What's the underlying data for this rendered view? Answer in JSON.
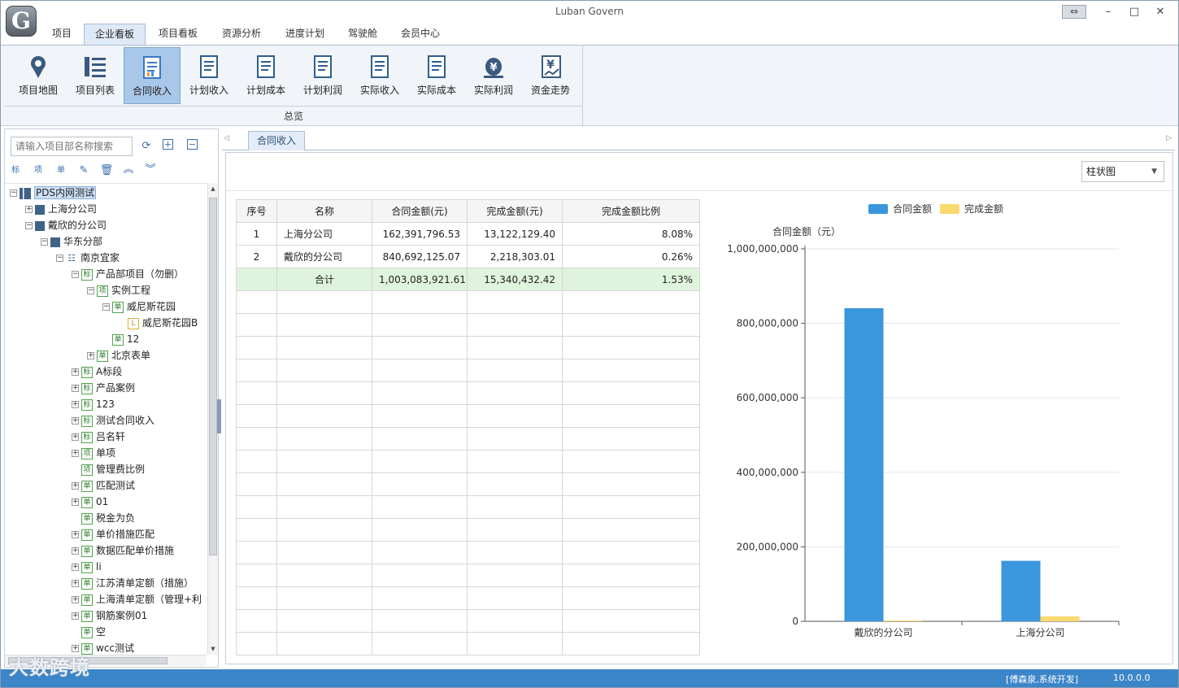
{
  "app": {
    "title": "Luban Govern",
    "logo_letter": "G",
    "restore_glyph": "⇔",
    "min_glyph": "–",
    "max_glyph": "□",
    "close_glyph": "✕"
  },
  "menu_tabs": [
    "项目",
    "企业看板",
    "项目看板",
    "资源分析",
    "进度计划",
    "驾驶舱",
    "会员中心"
  ],
  "active_menu_tab": "企业看板",
  "ribbon": {
    "group_label": "总览",
    "buttons": [
      {
        "label": "项目地图",
        "icon": "map-icon"
      },
      {
        "label": "项目列表",
        "icon": "list-icon"
      },
      {
        "label": "合同收入",
        "icon": "contract-income-icon",
        "active": true
      },
      {
        "label": "计划收入",
        "icon": "planned-income-icon"
      },
      {
        "label": "计划成本",
        "icon": "planned-cost-icon"
      },
      {
        "label": "计划利润",
        "icon": "planned-profit-icon"
      },
      {
        "label": "实际收入",
        "icon": "actual-income-icon"
      },
      {
        "label": "实际成本",
        "icon": "actual-cost-icon"
      },
      {
        "label": "实际利润",
        "icon": "actual-profit-icon"
      },
      {
        "label": "资金走势",
        "icon": "fund-trend-icon"
      }
    ]
  },
  "search": {
    "placeholder": "请输入项目部名称搜索"
  },
  "tree": [
    {
      "label": "PDS内网测试",
      "level": 0,
      "exp": "−",
      "ic": "root",
      "sel": true
    },
    {
      "label": "上海分公司",
      "level": 1,
      "exp": "+",
      "ic": "bld"
    },
    {
      "label": "戴欣的分公司",
      "level": 1,
      "exp": "−",
      "ic": "bld"
    },
    {
      "label": "华东分部",
      "level": 2,
      "exp": "−",
      "ic": "bld"
    },
    {
      "label": "南京宜家",
      "level": 3,
      "exp": "−",
      "ic": "tree"
    },
    {
      "label": "产品部项目（勿删）",
      "level": 4,
      "exp": "−",
      "ic": "box",
      "icText": "标"
    },
    {
      "label": "实例工程",
      "level": 5,
      "exp": "−",
      "ic": "box",
      "icText": "项"
    },
    {
      "label": "威尼斯花园",
      "level": 6,
      "exp": "−",
      "ic": "box",
      "icText": "单"
    },
    {
      "label": "威尼斯花园B",
      "level": 7,
      "exp": "",
      "ic": "sub",
      "icText": "L"
    },
    {
      "label": "12",
      "level": 6,
      "exp": "",
      "ic": "box",
      "icText": "单"
    },
    {
      "label": "北京表单",
      "level": 5,
      "exp": "+",
      "ic": "box",
      "icText": "单"
    },
    {
      "label": "A标段",
      "level": 4,
      "exp": "+",
      "ic": "box",
      "icText": "标"
    },
    {
      "label": "产品案例",
      "level": 4,
      "exp": "+",
      "ic": "box",
      "icText": "标"
    },
    {
      "label": "123",
      "level": 4,
      "exp": "+",
      "ic": "box",
      "icText": "标"
    },
    {
      "label": "测试合同收入",
      "level": 4,
      "exp": "+",
      "ic": "box",
      "icText": "标"
    },
    {
      "label": "吕名轩",
      "level": 4,
      "exp": "+",
      "ic": "box",
      "icText": "标"
    },
    {
      "label": "单项",
      "level": 4,
      "exp": "+",
      "ic": "box",
      "icText": "项"
    },
    {
      "label": "管理费比例",
      "level": 4,
      "exp": "",
      "ic": "box",
      "icText": "项"
    },
    {
      "label": "匹配测试",
      "level": 4,
      "exp": "+",
      "ic": "box",
      "icText": "单"
    },
    {
      "label": "01",
      "level": 4,
      "exp": "+",
      "ic": "box",
      "icText": "单"
    },
    {
      "label": "税金为负",
      "level": 4,
      "exp": "",
      "ic": "box",
      "icText": "单"
    },
    {
      "label": "单价措施匹配",
      "level": 4,
      "exp": "+",
      "ic": "box",
      "icText": "单"
    },
    {
      "label": "数据匹配单价措施",
      "level": 4,
      "exp": "+",
      "ic": "box",
      "icText": "单"
    },
    {
      "label": "li",
      "level": 4,
      "exp": "+",
      "ic": "box",
      "icText": "单"
    },
    {
      "label": "江苏清单定额（措施）",
      "level": 4,
      "exp": "+",
      "ic": "box",
      "icText": "单"
    },
    {
      "label": "上海清单定额（管理+利",
      "level": 4,
      "exp": "+",
      "ic": "box",
      "icText": "单"
    },
    {
      "label": "钢筋案例01",
      "level": 4,
      "exp": "+",
      "ic": "box",
      "icText": "单"
    },
    {
      "label": "空",
      "level": 4,
      "exp": "",
      "ic": "box",
      "icText": "单"
    },
    {
      "label": "wcc测试",
      "level": 4,
      "exp": "+",
      "ic": "box",
      "icText": "单"
    }
  ],
  "doc_tab": {
    "label": "合同收入"
  },
  "chart_select": {
    "value": "柱状图"
  },
  "table": {
    "headers": [
      "序号",
      "名称",
      "合同金额(元)",
      "完成金额(元)",
      "完成金额比例"
    ],
    "rows": [
      [
        "1",
        "上海分公司",
        "162,391,796.53",
        "13,122,129.40",
        "8.08%"
      ],
      [
        "2",
        "戴欣的分公司",
        "840,692,125.07",
        "2,218,303.01",
        "0.26%"
      ]
    ],
    "total": [
      "",
      "合计",
      "1,003,083,921.61",
      "15,340,432.42",
      "1.53%"
    ],
    "empty_rows": 16
  },
  "chart_data": {
    "type": "bar",
    "categories": [
      "戴欣的分公司",
      "上海分公司"
    ],
    "series": [
      {
        "name": "合同金额",
        "color": "#3a96dd",
        "values": [
          840692125.07,
          162391796.53
        ]
      },
      {
        "name": "完成金额",
        "color": "#fad96e",
        "values": [
          2218303.01,
          13122129.4
        ]
      }
    ],
    "ylabel": "合同金额（元）",
    "ylim": [
      0,
      1000000000
    ],
    "yticks": [
      "0",
      "200,000,000",
      "400,000,000",
      "600,000,000",
      "800,000,000",
      "1,000,000,000"
    ],
    "grid": true,
    "legend": "top"
  },
  "status": {
    "user": "[傅森泉,系统开发]",
    "version": "10.0.0.0"
  },
  "watermark": "大数跨境"
}
